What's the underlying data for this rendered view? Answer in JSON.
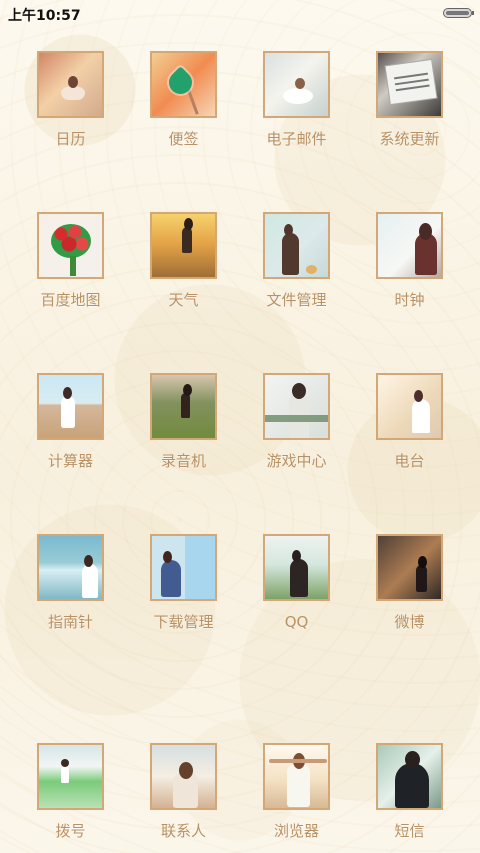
{
  "status_bar": {
    "time": "上午10:57"
  },
  "apps": [
    {
      "label": "日历",
      "icon": "calendar-icon"
    },
    {
      "label": "便签",
      "icon": "note-icon"
    },
    {
      "label": "电子邮件",
      "icon": "email-icon"
    },
    {
      "label": "系统更新",
      "icon": "system-update-icon"
    },
    {
      "label": "百度地图",
      "icon": "baidu-map-icon"
    },
    {
      "label": "天气",
      "icon": "weather-icon"
    },
    {
      "label": "文件管理",
      "icon": "file-manager-icon"
    },
    {
      "label": "时钟",
      "icon": "clock-icon"
    },
    {
      "label": "计算器",
      "icon": "calculator-icon"
    },
    {
      "label": "录音机",
      "icon": "recorder-icon"
    },
    {
      "label": "游戏中心",
      "icon": "game-center-icon"
    },
    {
      "label": "电台",
      "icon": "radio-icon"
    },
    {
      "label": "指南针",
      "icon": "compass-icon"
    },
    {
      "label": "下载管理",
      "icon": "download-manager-icon"
    },
    {
      "label": "QQ",
      "icon": "qq-icon"
    },
    {
      "label": "微博",
      "icon": "weibo-icon"
    }
  ],
  "dock": [
    {
      "label": "拨号",
      "icon": "dialer-icon"
    },
    {
      "label": "联系人",
      "icon": "contacts-icon"
    },
    {
      "label": "浏览器",
      "icon": "browser-icon"
    },
    {
      "label": "短信",
      "icon": "sms-icon"
    }
  ]
}
